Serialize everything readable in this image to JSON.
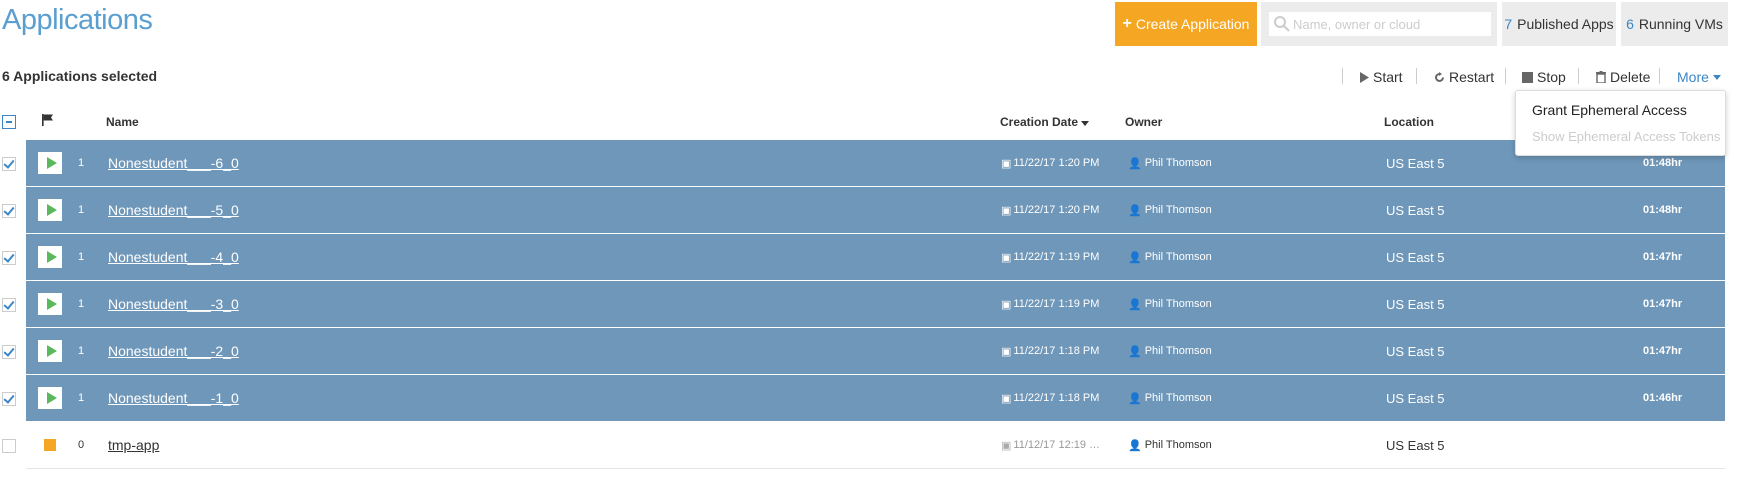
{
  "page_title": "Applications",
  "toolbar": {
    "create_label": "Create Application",
    "search_placeholder": "Name, owner or cloud",
    "published_count": "7",
    "published_label": "Published Apps",
    "running_count": "6",
    "running_label": "Running VMs"
  },
  "selection": {
    "summary": "6 Applications selected"
  },
  "actions": {
    "start": "Start",
    "restart": "Restart",
    "stop": "Stop",
    "delete": "Delete",
    "more": "More"
  },
  "columns": {
    "name": "Name",
    "creation_date": "Creation Date",
    "owner": "Owner",
    "location": "Location"
  },
  "more_menu": {
    "grant": "Grant Ephemeral Access",
    "show_tokens": "Show Ephemeral Access Tokens"
  },
  "rows": [
    {
      "selected": true,
      "status": "running",
      "count": "1",
      "name": "Nonestudent___-6_0",
      "date": "11/22/17 1:20 PM",
      "owner": "Phil Thomson",
      "location": "US East 5",
      "runtime": "01:48hr"
    },
    {
      "selected": true,
      "status": "running",
      "count": "1",
      "name": "Nonestudent___-5_0",
      "date": "11/22/17 1:20 PM",
      "owner": "Phil Thomson",
      "location": "US East 5",
      "runtime": "01:48hr"
    },
    {
      "selected": true,
      "status": "running",
      "count": "1",
      "name": "Nonestudent___-4_0",
      "date": "11/22/17 1:19 PM",
      "owner": "Phil Thomson",
      "location": "US East 5",
      "runtime": "01:47hr"
    },
    {
      "selected": true,
      "status": "running",
      "count": "1",
      "name": "Nonestudent___-3_0",
      "date": "11/22/17 1:19 PM",
      "owner": "Phil Thomson",
      "location": "US East 5",
      "runtime": "01:47hr"
    },
    {
      "selected": true,
      "status": "running",
      "count": "1",
      "name": "Nonestudent___-2_0",
      "date": "11/22/17 1:18 PM",
      "owner": "Phil Thomson",
      "location": "US East 5",
      "runtime": "01:47hr"
    },
    {
      "selected": true,
      "status": "running",
      "count": "1",
      "name": "Nonestudent___-1_0",
      "date": "11/22/17 1:18 PM",
      "owner": "Phil Thomson",
      "location": "US East 5",
      "runtime": "01:46hr"
    },
    {
      "selected": false,
      "status": "stopped",
      "count": "0",
      "name": "tmp-app",
      "date": "11/12/17 12:19 …",
      "owner": "Phil Thomson",
      "location": "US East 5",
      "runtime": ""
    }
  ],
  "colors": {
    "accent": "#5a9fd0",
    "create_button": "#f5a623",
    "selected_row": "#6f97b9",
    "running": "#5cb85c",
    "stopped": "#f5a623"
  }
}
